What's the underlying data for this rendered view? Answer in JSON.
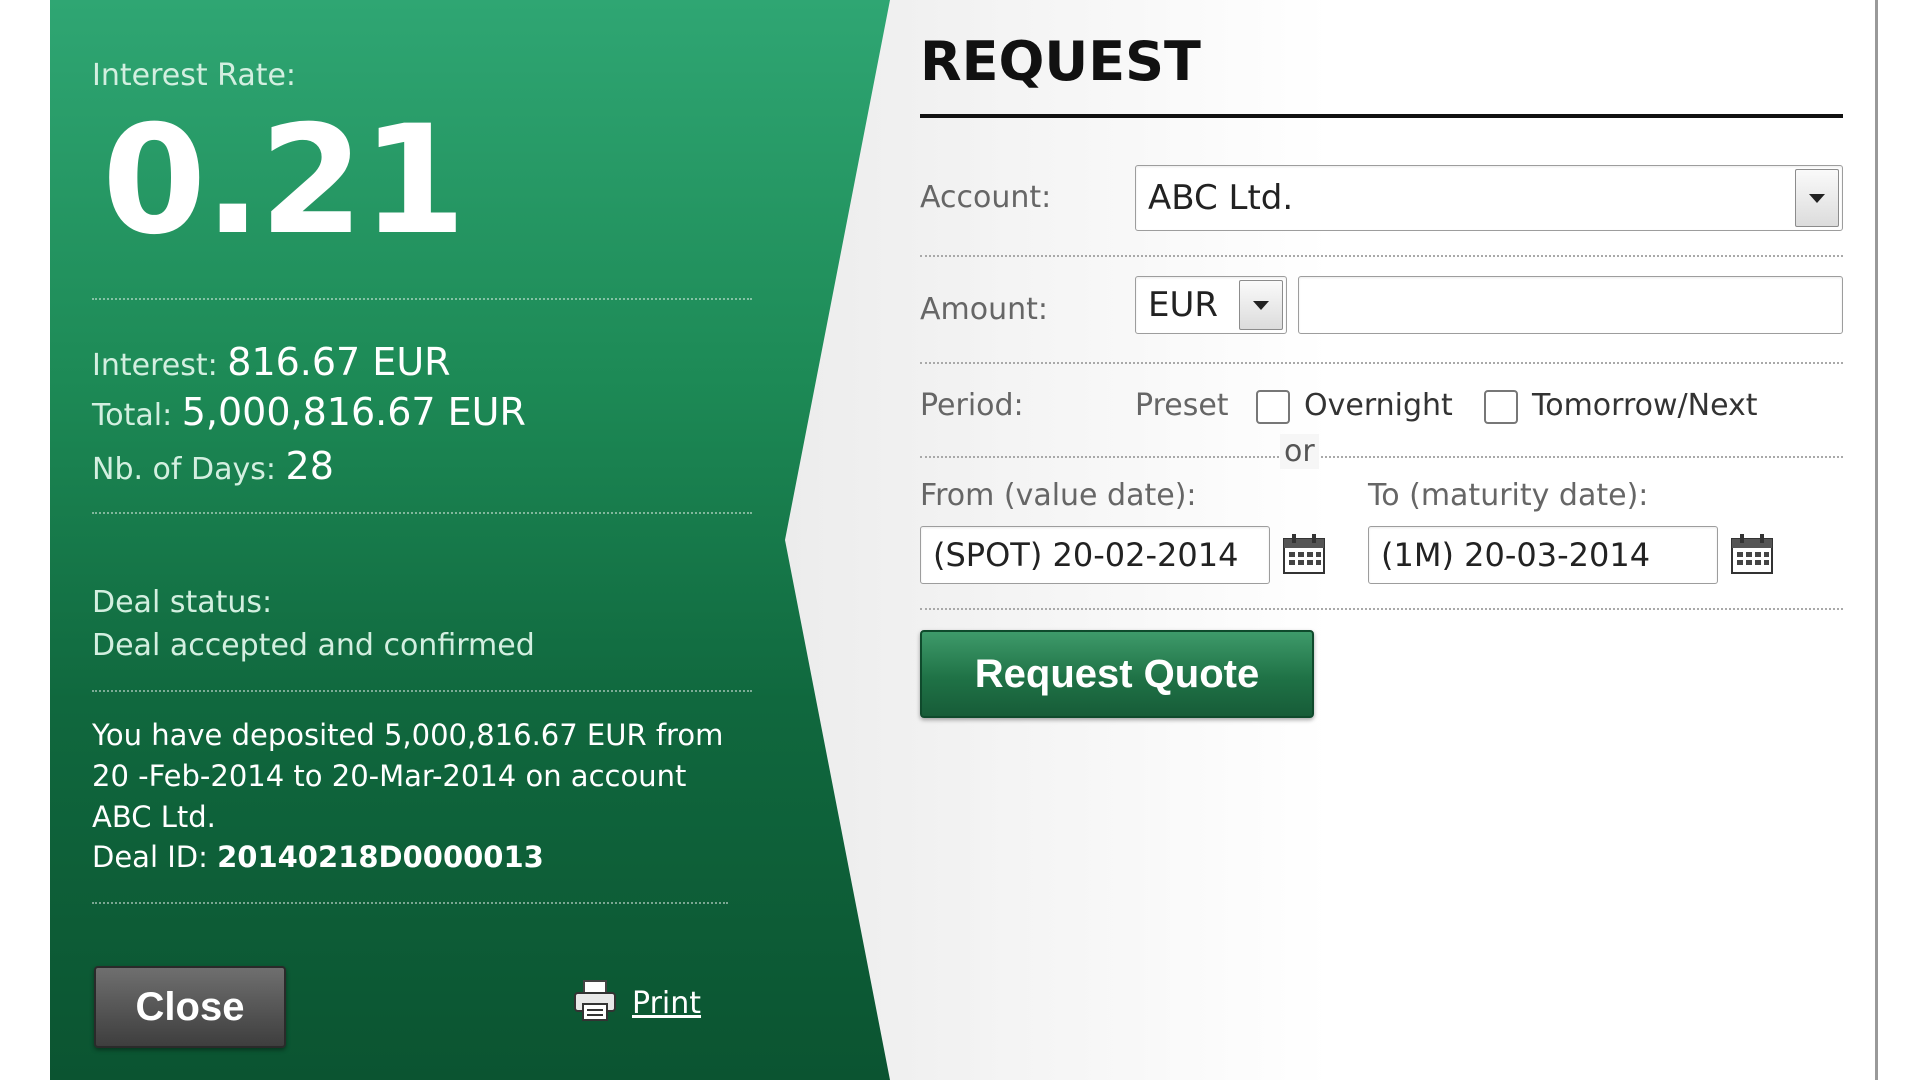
{
  "left_panel": {
    "interest_rate_label": "Interest Rate:",
    "interest_rate_value": "0.21",
    "interest_label": "Interest:",
    "interest_value": "816.67 EUR",
    "total_label": "Total:",
    "total_value": "5,000,816.67 EUR",
    "days_label": "Nb. of Days:",
    "days_value": "28",
    "deal_status_label": "Deal status:",
    "deal_status_value": "Deal accepted and confirmed",
    "deposit_message": "You have deposited 5,000,816.67 EUR from 20 -Feb-2014 to 20-Mar-2014 on account ABC Ltd.",
    "deal_id_label": "Deal ID:",
    "deal_id_value": "20140218D0000013",
    "close_label": "Close",
    "print_label": "Print"
  },
  "request": {
    "title": "REQUEST",
    "account_label": "Account:",
    "account_value": "ABC Ltd.",
    "amount_label": "Amount:",
    "currency_value": "EUR",
    "amount_value": "",
    "period_label": "Period:",
    "preset_label": "Preset",
    "overnight_label": "Overnight",
    "tomorrow_next_label": "Tomorrow/Next",
    "or_label": "or",
    "from_label": "From (value date):",
    "from_value": "(SPOT) 20-02-2014",
    "to_label": "To (maturity date):",
    "to_value": "(1M) 20-03-2014",
    "request_quote_label": "Request Quote"
  },
  "icons": [
    "printer-icon",
    "calendar-icon",
    "chevron-down-icon"
  ],
  "colors": {
    "green_top": "#2fa673",
    "green_bottom": "#0b5431",
    "button_green": "#1f7246"
  }
}
